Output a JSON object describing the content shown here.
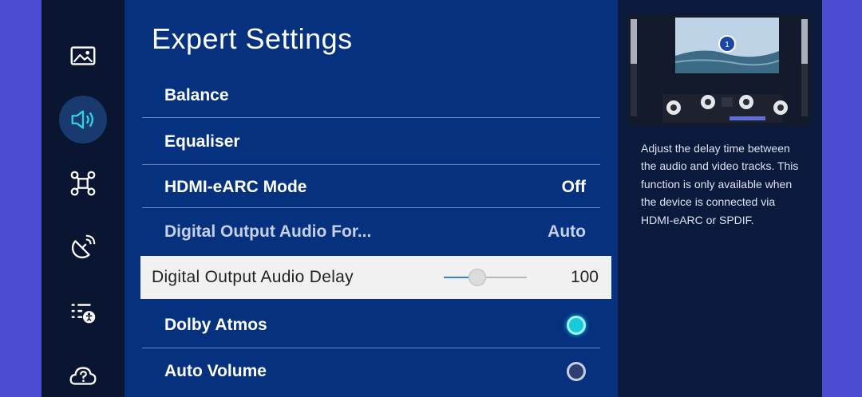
{
  "panel": {
    "title": "Expert Settings"
  },
  "menu": [
    {
      "label": "Balance",
      "value": ""
    },
    {
      "label": "Equaliser",
      "value": ""
    },
    {
      "label": "HDMI-eARC Mode",
      "value": "Off"
    },
    {
      "label": "Digital Output Audio For...",
      "value": "Auto"
    }
  ],
  "selected": {
    "label": "Digital Output Audio Delay",
    "value": "100",
    "level": 0.38
  },
  "toggles": [
    {
      "label": "Dolby Atmos",
      "state": "on"
    },
    {
      "label": "Auto Volume",
      "state": "off"
    }
  ],
  "preview": {
    "badge": "1"
  },
  "info": {
    "text": "Adjust the delay time between the audio and video tracks. This function is only available when the device is connected via HDMI-eARC or SPDIF."
  },
  "sidebar_icons": [
    "picture-icon",
    "sound-icon",
    "connection-icon",
    "broadcast-icon",
    "accessibility-icon",
    "support-icon"
  ],
  "colors": {
    "panel_bg": "#05317f",
    "selected_bg": "#f1f1f1",
    "toggle_on": "#17c9d9",
    "outer_bg": "#4a4bd0"
  }
}
